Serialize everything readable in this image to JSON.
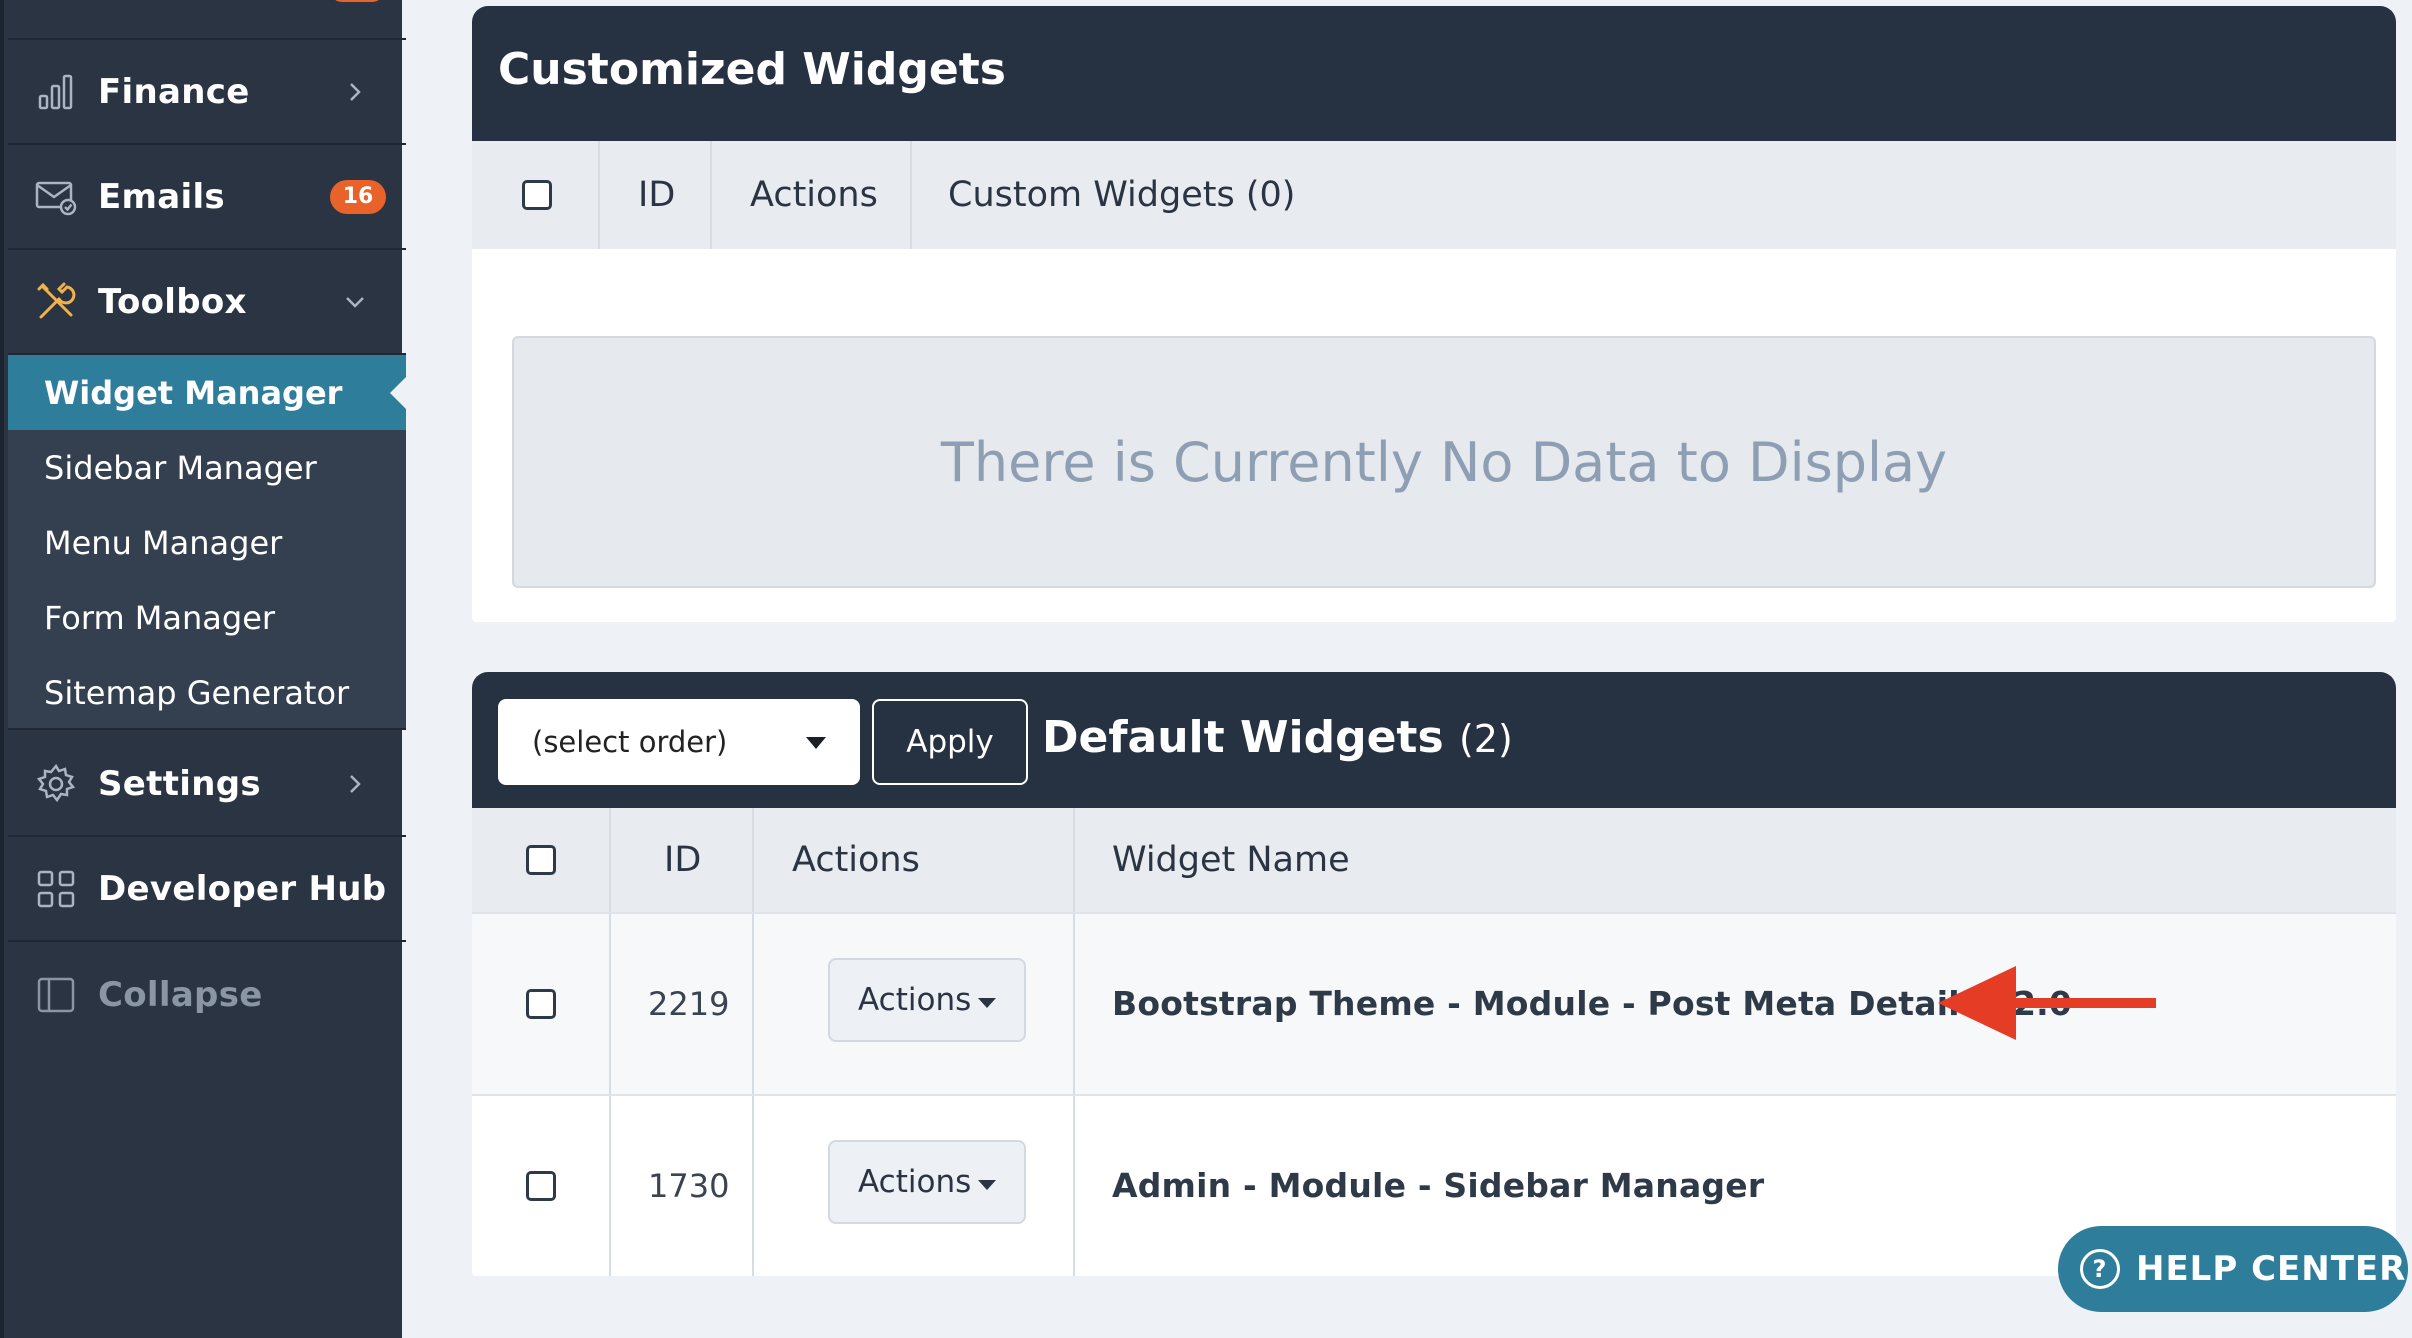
{
  "sidebar": {
    "items": [
      {
        "key": "finance",
        "label": "Finance",
        "icon": "bar-chart-icon",
        "chevron": "right"
      },
      {
        "key": "emails",
        "label": "Emails",
        "icon": "email-icon",
        "badge": "16"
      },
      {
        "key": "toolbox",
        "label": "Toolbox",
        "icon": "tools-icon",
        "chevron": "down"
      },
      {
        "key": "settings",
        "label": "Settings",
        "icon": "gear-icon",
        "chevron": "right"
      },
      {
        "key": "developer_hub",
        "label": "Developer Hub",
        "icon": "grid-icon"
      },
      {
        "key": "collapse",
        "label": "Collapse",
        "icon": "panel-icon"
      }
    ],
    "toolbox_subitems": [
      {
        "label": "Widget Manager",
        "active": true
      },
      {
        "label": "Sidebar Manager"
      },
      {
        "label": "Menu Manager"
      },
      {
        "label": "Form Manager"
      },
      {
        "label": "Sitemap Generator"
      }
    ]
  },
  "custom_panel": {
    "title": "Customized Widgets",
    "columns": [
      "ID",
      "Actions",
      "Custom Widgets (0)"
    ],
    "empty_message": "There is Currently No Data to Display"
  },
  "default_panel": {
    "title": "Default Widgets",
    "count": "(2)",
    "order_select": {
      "value": "(select order)"
    },
    "apply_label": "Apply",
    "columns": [
      "ID",
      "Actions",
      "Widget Name"
    ],
    "rows": [
      {
        "id": "2219",
        "actions_label": "Actions",
        "name": "Bootstrap Theme - Module - Post Meta Details v2.0"
      },
      {
        "id": "1730",
        "actions_label": "Actions",
        "name": "Admin - Module - Sidebar Manager"
      }
    ]
  },
  "help": {
    "label": "HELP CENTER",
    "icon": "question-icon"
  },
  "colors": {
    "sidebar_bg": "#2a3442",
    "active_item": "#2e7d9a",
    "badge": "#e8622a",
    "panel_header": "#263141",
    "annotation_arrow": "#e53c25"
  }
}
